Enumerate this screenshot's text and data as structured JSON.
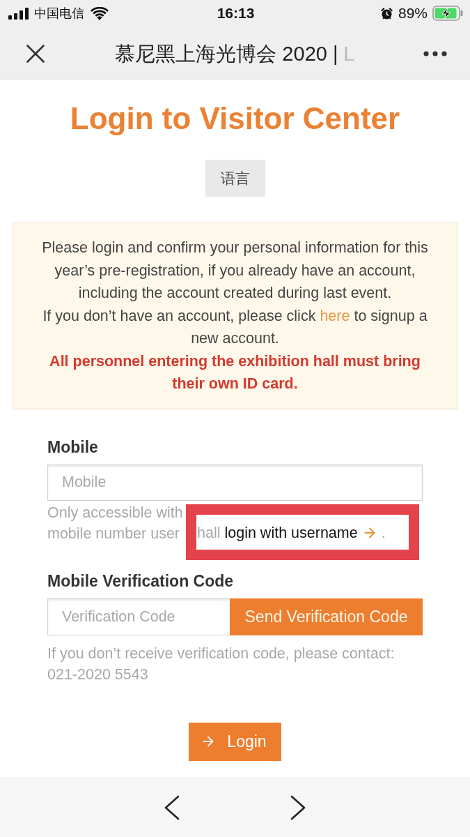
{
  "status_bar": {
    "carrier": "中国电信",
    "time": "16:13",
    "battery": "89%"
  },
  "nav_bar": {
    "title": "慕尼黑上海光博会 2020 | L"
  },
  "header": {
    "title": "Login to Visitor Center",
    "language_button": "语言"
  },
  "notice": {
    "intro": "Please login and confirm your personal information for this year’s pre-registration, if you already have an account, including the account created during last event.",
    "signup": {
      "before": "If you don’t have an account, please click",
      "link": "here",
      "after": "to signup a new account."
    },
    "warning": "All personnel entering the exhibition hall must bring their own ID card."
  },
  "mobile": {
    "label": "Mobile",
    "placeholder": "Mobile",
    "hint": {
      "line_1": "Only accessible with",
      "line_2": "mobile number user",
      "framed": {
        "word": "hall",
        "link": "login with username",
        "end": "."
      }
    }
  },
  "verification": {
    "label": "Mobile Verification Code",
    "placeholder": "Verification Code",
    "send_button": "Send Verification Code",
    "hint": "If you don’t receive verification code, please contact: 021-2020 5543"
  },
  "login_button": "Login"
}
